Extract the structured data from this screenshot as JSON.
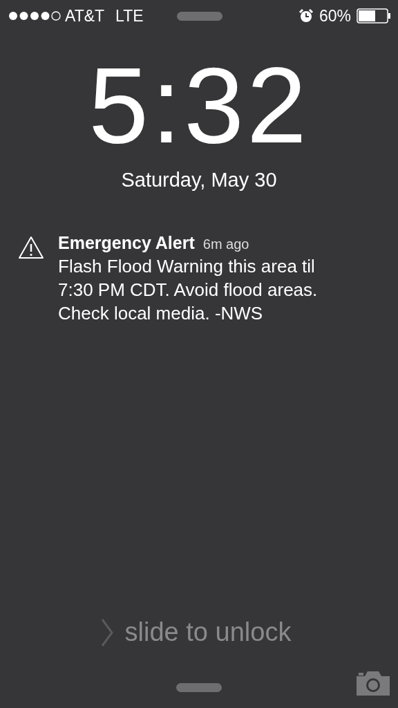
{
  "status_bar": {
    "carrier": "AT&T",
    "network": "LTE",
    "battery_percent": "60%"
  },
  "clock": {
    "time": "5:32",
    "date": "Saturday, May 30"
  },
  "notification": {
    "title": "Emergency Alert",
    "time": "6m ago",
    "body": "Flash Flood Warning this area til 7:30 PM CDT. Avoid flood areas. Check local media. -NWS"
  },
  "unlock": {
    "label": "slide to unlock"
  }
}
